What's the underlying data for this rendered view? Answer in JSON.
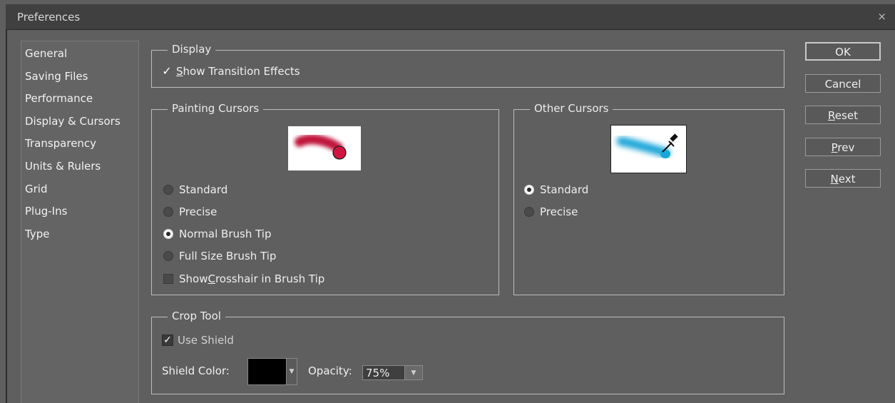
{
  "window": {
    "title": "Preferences",
    "close_glyph": "×"
  },
  "sidebar": {
    "items": [
      {
        "label": "General"
      },
      {
        "label": "Saving Files"
      },
      {
        "label": "Performance"
      },
      {
        "label": "Display & Cursors"
      },
      {
        "label": "Transparency"
      },
      {
        "label": "Units & Rulers"
      },
      {
        "label": "Grid"
      },
      {
        "label": "Plug-Ins"
      },
      {
        "label": "Type"
      }
    ]
  },
  "display": {
    "legend": "Display",
    "show_transition": {
      "label_first": "S",
      "label_rest": "how Transition Effects",
      "checked": true
    }
  },
  "painting_cursors": {
    "legend": "Painting Cursors",
    "options": [
      {
        "label": "Standard",
        "selected": false
      },
      {
        "label": "Precise",
        "selected": false
      },
      {
        "label": "Normal Brush Tip",
        "selected": true
      },
      {
        "label": "Full Size Brush Tip",
        "selected": false
      }
    ],
    "crosshair": {
      "label_pre": "Show ",
      "label_key": "C",
      "label_post": "rosshair in Brush Tip",
      "checked": false
    }
  },
  "other_cursors": {
    "legend": "Other Cursors",
    "options": [
      {
        "label": "Standard",
        "selected": true
      },
      {
        "label": "Precise",
        "selected": false
      }
    ]
  },
  "crop_tool": {
    "legend": "Crop Tool",
    "use_shield": {
      "label": "Use Shield",
      "checked": true
    },
    "shield_color_label": "Shield Color:",
    "shield_color": "#000000",
    "opacity_label": "Opacity:",
    "opacity_value": "75%"
  },
  "buttons": {
    "ok": "OK",
    "cancel": "Cancel",
    "reset_key": "R",
    "reset_rest": "eset",
    "prev_key": "P",
    "prev_rest": "rev",
    "next_key": "N",
    "next_rest": "ext"
  },
  "icons": {
    "checkmark": "✓",
    "dropdown": "▼"
  },
  "colors": {
    "brush_red": "#c0143c",
    "brush_blue": "#1aa6d8"
  }
}
